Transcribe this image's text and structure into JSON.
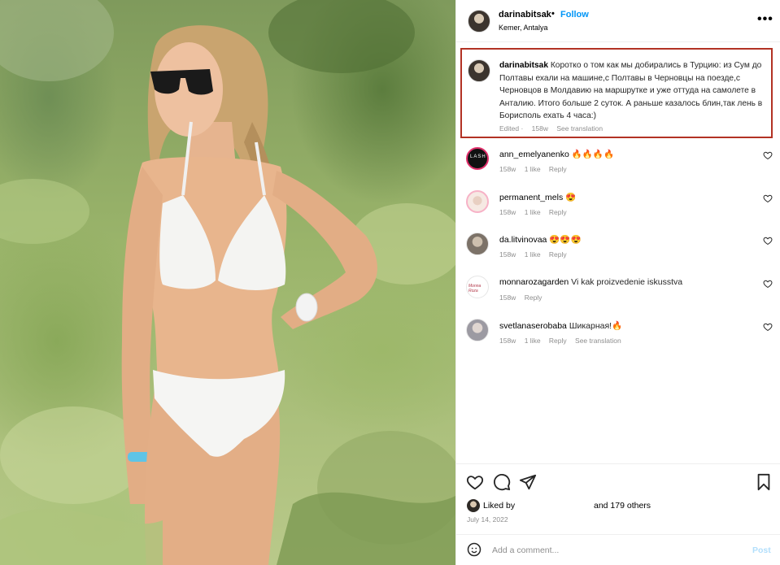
{
  "post": {
    "username": "darinabitsak",
    "separator": "•",
    "follow_label": "Follow",
    "location": "Kemer, Antalya",
    "more_label": "•••"
  },
  "caption": {
    "username": "darinabitsak",
    "text": "Коротко о том как мы добирались в Турцию: из Сум до Полтавы ехали на машине,с Полтавы в Черновцы на поезде,с Черновцов в Молдавию на маршрутке и уже оттуда на самолете в Анталию. Итого больше 2 суток. А раньше казалось блин,так лень в Борисполь ехать 4 часа:)",
    "edited": "Edited",
    "age": "158w",
    "translate": "See translation"
  },
  "comments": [
    {
      "username": "ann_emelyanenko",
      "text": "🔥🔥🔥🔥",
      "age": "158w",
      "likes": "1 like",
      "reply": "Reply",
      "translate": ""
    },
    {
      "username": "permanent_mels",
      "text": "😍",
      "age": "158w",
      "likes": "1 like",
      "reply": "Reply",
      "translate": ""
    },
    {
      "username": "da.litvinovaa",
      "text": "😍😍😍",
      "age": "158w",
      "likes": "1 like",
      "reply": "Reply",
      "translate": ""
    },
    {
      "username": "monnarozagarden",
      "text": "Vi kak proizvedenie iskusstva",
      "age": "158w",
      "likes": "",
      "reply": "Reply",
      "translate": ""
    },
    {
      "username": "svetlanaserobaba",
      "text": "Шикарная!🔥",
      "age": "158w",
      "likes": "1 like",
      "reply": "Reply",
      "translate": "See translation"
    }
  ],
  "likes": {
    "liked_by": "Liked by",
    "others": "and 179 others"
  },
  "date": "July 14, 2022",
  "add_comment": {
    "placeholder": "Add a comment...",
    "post_label": "Post"
  },
  "avatar_texts": {
    "lash": "LASH",
    "monna": "Monna Roza"
  },
  "colors": {
    "follow_blue": "#0095f6",
    "post_disabled": "#b2dffc",
    "highlight_border": "#b23224",
    "meta_gray": "#8e8e8e"
  }
}
